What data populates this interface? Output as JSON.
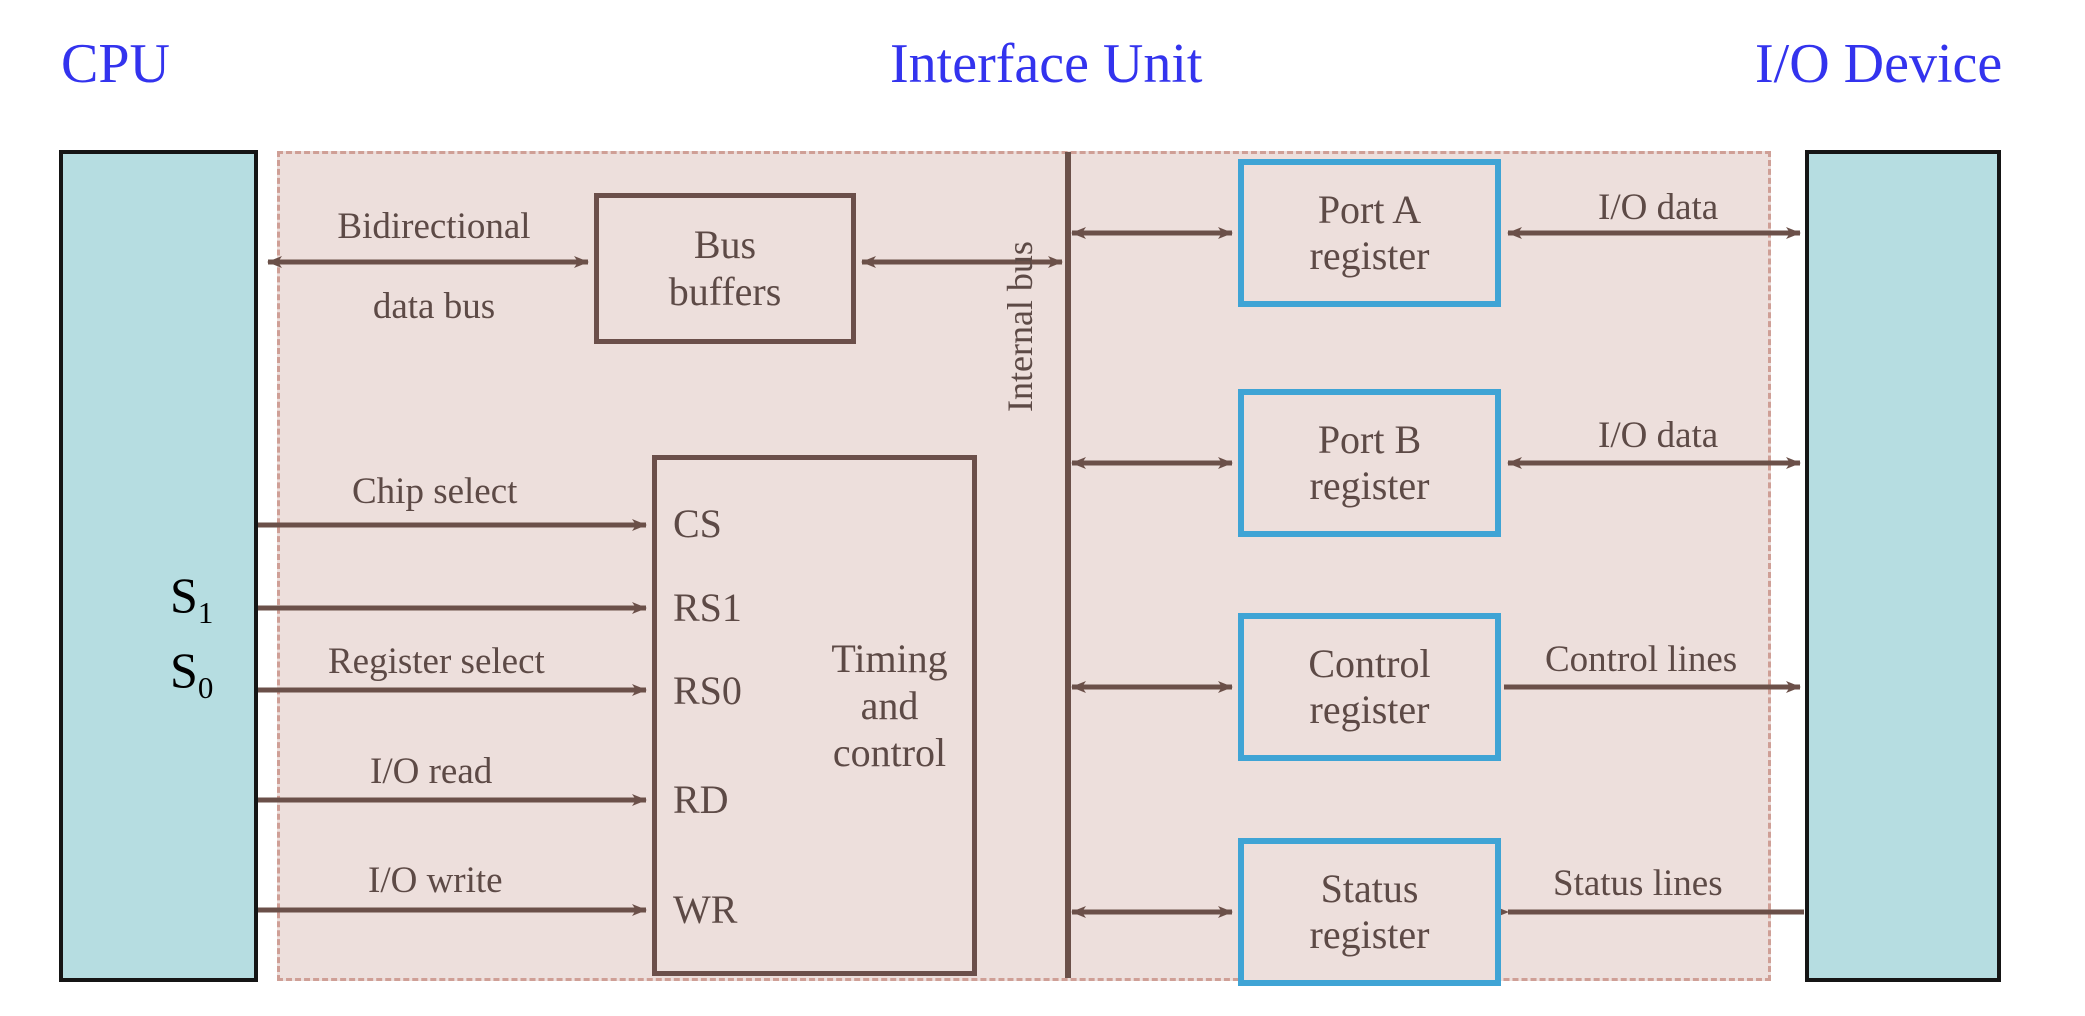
{
  "headers": {
    "cpu": "CPU",
    "interface_unit": "Interface Unit",
    "io_device": "I/O Device"
  },
  "cpu_block": {
    "signal_s1": "S",
    "signal_s1_sub": "1",
    "signal_s0": "S",
    "signal_s0_sub": "0"
  },
  "interface": {
    "bus_buffers": {
      "line1": "Bus",
      "line2": "buffers"
    },
    "timing_control": {
      "line1": "Timing",
      "line2": "and",
      "line3": "control",
      "pins": [
        "CS",
        "RS1",
        "RS0",
        "RD",
        "WR"
      ]
    },
    "internal_bus_label": "Internal bus",
    "registers": [
      {
        "line1": "Port A",
        "line2": "register"
      },
      {
        "line1": "Port B",
        "line2": "register"
      },
      {
        "line1": "Control",
        "line2": "register"
      },
      {
        "line1": "Status",
        "line2": "register"
      }
    ]
  },
  "wire_labels": {
    "bidirectional_data_bus_l1": "Bidirectional",
    "bidirectional_data_bus_l2": "data bus",
    "chip_select": "Chip select",
    "register_select": "Register select",
    "io_read": "I/O read",
    "io_write": "I/O write",
    "io_data_a": "I/O data",
    "io_data_b": "I/O data",
    "control_lines": "Control lines",
    "status_lines": "Status lines"
  },
  "colors": {
    "header_text": "#3333ee",
    "end_block_fill": "#b6dde1",
    "end_block_border": "#151515",
    "interface_fill": "#eddfdc",
    "interface_dash_border": "#cf9f96",
    "brown_box_border": "#6b4f4a",
    "register_border": "#3fa4d5",
    "wire": "#6b5049",
    "body_text": "#5d4a46"
  }
}
